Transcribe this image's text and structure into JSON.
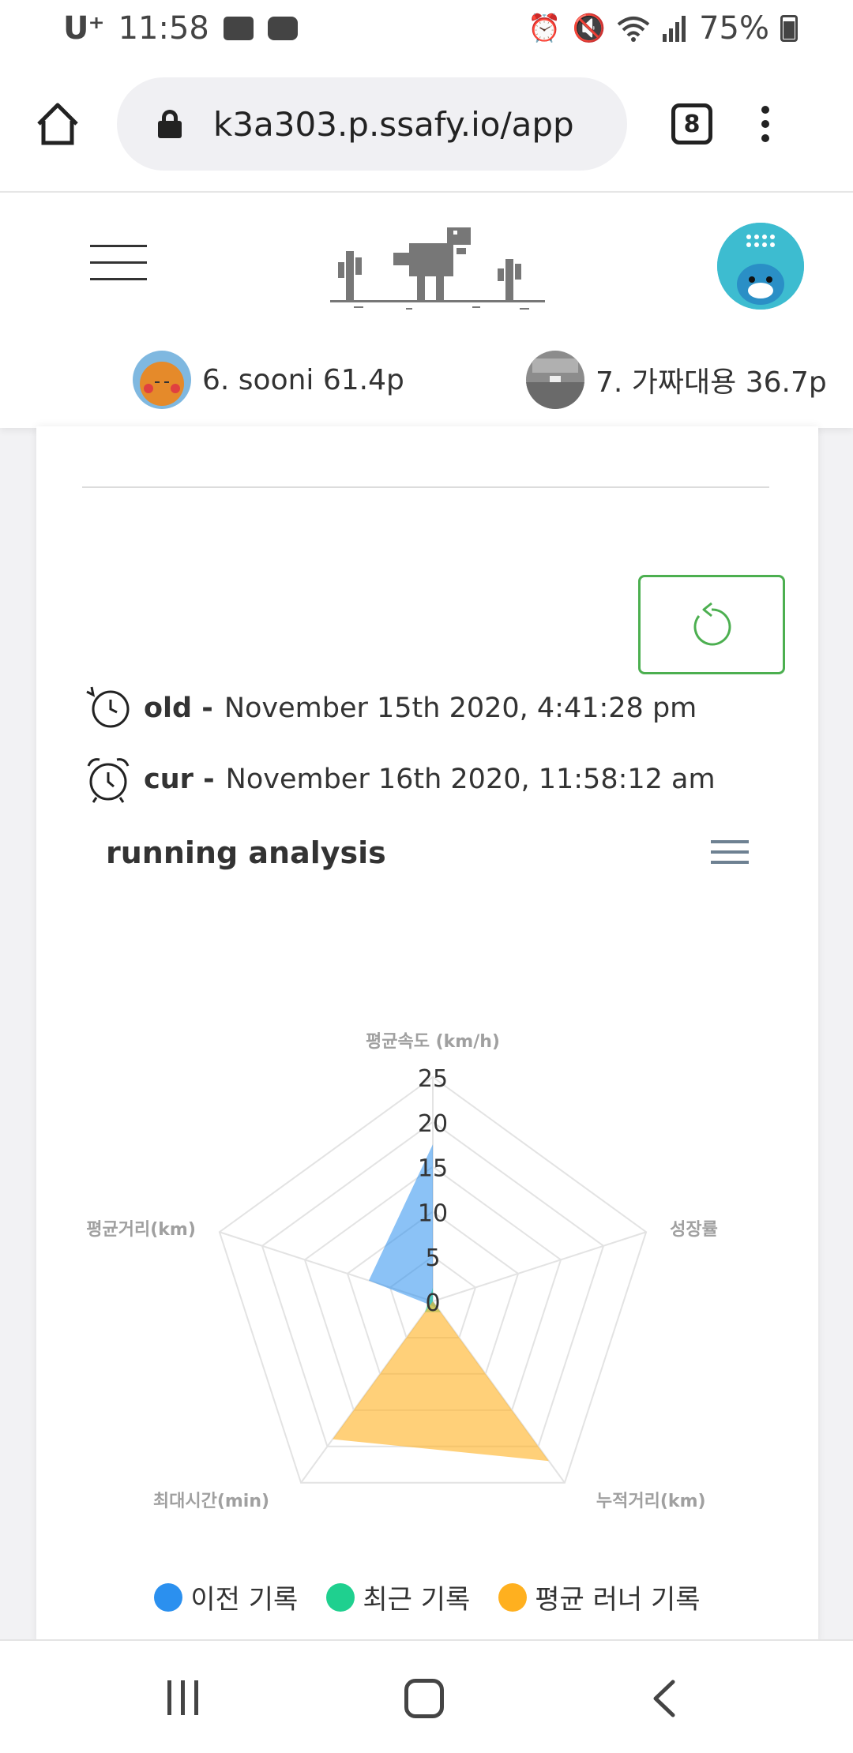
{
  "status_bar": {
    "carrier": "U⁺",
    "time": "11:58",
    "battery": "75%",
    "icons": [
      "gallery-icon",
      "youtube-icon",
      "alarm-icon",
      "mute-icon",
      "wifi-icon",
      "signal-icon",
      "battery-icon"
    ]
  },
  "browser": {
    "url": "k3a303.p.ssafy.io/app",
    "tab_count": "8"
  },
  "header": {
    "logo": "dino-logo",
    "ranks": [
      {
        "text": "6. sooni 61.4p"
      },
      {
        "text": "7. 가짜대용 36.7p"
      }
    ]
  },
  "records": {
    "old": {
      "label": "old -",
      "value": "November 15th 2020, 4:41:28 pm"
    },
    "cur": {
      "label": "cur -",
      "value": "November 16th 2020, 11:58:12 am"
    }
  },
  "chart_title": "running analysis",
  "chart_data": {
    "type": "radar",
    "axes": [
      "평균속도 (km/h)",
      "성장률",
      "누적거리(km)",
      "최대시간(min)",
      "평균거리(km)"
    ],
    "scale_ticks": [
      "0",
      "5",
      "10",
      "15",
      "20",
      "25"
    ],
    "max": 25,
    "series": [
      {
        "name": "이전 기록",
        "color": "#2b90ef",
        "values": [
          17.5,
          0,
          1,
          0.5,
          7.5
        ]
      },
      {
        "name": "최근 기록",
        "color": "#1fd08f",
        "values": [
          1.5,
          0,
          1.5,
          1.5,
          0.5
        ]
      },
      {
        "name": "평균 러너 기록",
        "color": "#ffb01f",
        "values": [
          0,
          0,
          22,
          19,
          0
        ]
      }
    ]
  },
  "colors": {
    "accent_green": "#4caf50",
    "menu_gray": "#6e8192"
  }
}
